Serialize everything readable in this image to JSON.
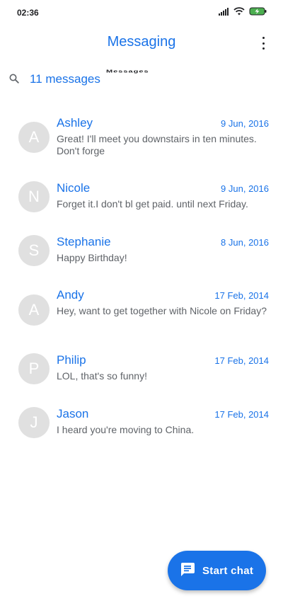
{
  "status_bar": {
    "time": "02:36",
    "icons": [
      "signal-icon",
      "wifi-icon",
      "battery-charging-icon"
    ],
    "battery_color": "#4caf50"
  },
  "app_bar": {
    "title": "Messaging",
    "menu_icon": "overflow-menu-icon"
  },
  "search": {
    "icon": "search-icon",
    "count_label": "11 messages",
    "ghost_text": "Messages"
  },
  "colors": {
    "accent": "#1a73e8",
    "avatar_bg": "#e0e0e0",
    "snippet": "#5f6368"
  },
  "messages": [
    {
      "initial": "A",
      "name": "Ashley",
      "date": "9 Jun, 2016",
      "snippet": "Great! I'll meet you downstairs in ten minutes. Don't forge"
    },
    {
      "initial": "N",
      "name": "Nicole",
      "date": "9 Jun, 2016",
      "snippet": "Forget it.I don't bl get paid. until next Friday."
    },
    {
      "initial": "S",
      "name": "Stephanie",
      "date": "8 Jun, 2016",
      "snippet": "Happy Birthday!"
    },
    {
      "initial": "A",
      "name": "Andy",
      "date": "17 Feb, 2014",
      "snippet": "Hey, want to get together with Nicole on Friday?"
    },
    {
      "initial": "P",
      "name": "Philip",
      "date": "17 Feb, 2014",
      "snippet": "LOL, that's so funny!"
    },
    {
      "initial": "J",
      "name": "Jason",
      "date": "17 Feb, 2014",
      "snippet": "I heard you're moving to China."
    }
  ],
  "fab": {
    "icon": "chat-icon",
    "label": "Start chat"
  }
}
